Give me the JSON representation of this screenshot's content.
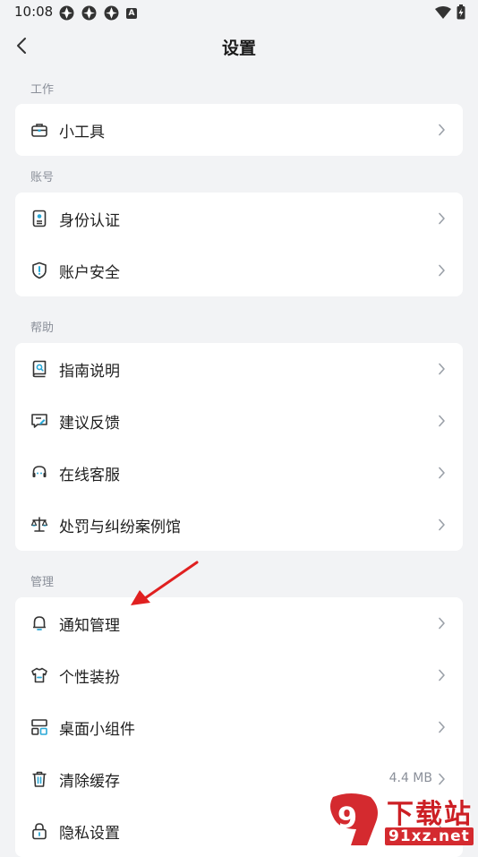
{
  "status_bar": {
    "time": "10:08",
    "notif_badge": "A"
  },
  "header": {
    "title": "设置"
  },
  "sections": [
    {
      "label": "工作",
      "items": [
        {
          "label": "小工具",
          "icon": "toolbox-icon"
        }
      ]
    },
    {
      "label": "账号",
      "items": [
        {
          "label": "身份认证",
          "icon": "id-card-icon"
        },
        {
          "label": "账户安全",
          "icon": "shield-icon"
        }
      ]
    },
    {
      "label": "帮助",
      "items": [
        {
          "label": "指南说明",
          "icon": "guide-book-icon"
        },
        {
          "label": "建议反馈",
          "icon": "feedback-icon"
        },
        {
          "label": "在线客服",
          "icon": "headset-icon"
        },
        {
          "label": "处罚与纠纷案例馆",
          "icon": "scale-icon"
        }
      ]
    },
    {
      "label": "管理",
      "items": [
        {
          "label": "通知管理",
          "icon": "bell-icon"
        },
        {
          "label": "个性装扮",
          "icon": "tshirt-icon"
        },
        {
          "label": "桌面小组件",
          "icon": "widget-icon"
        },
        {
          "label": "清除缓存",
          "icon": "trash-icon",
          "value": "4.4 MB"
        },
        {
          "label": "隐私设置",
          "icon": "lock-icon"
        }
      ]
    }
  ],
  "watermark": {
    "title": "下载站",
    "url": "91xz.net",
    "logo_text": "9"
  },
  "colors": {
    "background": "#f2f3f5",
    "card": "#ffffff",
    "accent_annotation": "#e02020",
    "watermark_red": "#cc1f24"
  }
}
